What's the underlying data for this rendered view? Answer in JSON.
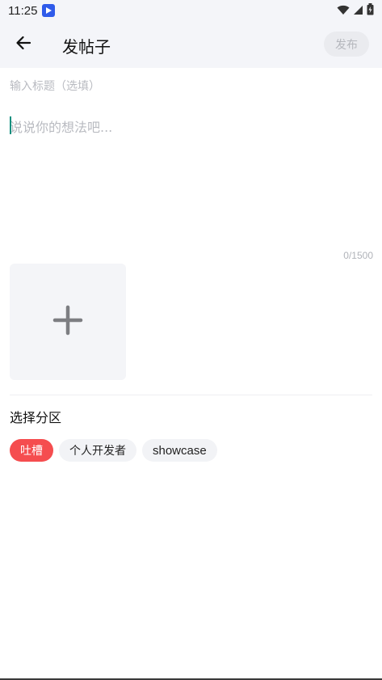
{
  "status_bar": {
    "time": "11:25",
    "app_icon": "play-app-icon",
    "icons": [
      "wifi-icon",
      "signal-icon",
      "battery-icon"
    ]
  },
  "app_bar": {
    "back_icon": "arrow-left-icon",
    "title": "发帖子",
    "publish_label": "发布"
  },
  "editor": {
    "title_placeholder": "输入标题（选填）",
    "title_value": "",
    "content_placeholder": "说说你的想法吧...",
    "content_value": "",
    "counter": "0/1500",
    "add_image_icon": "plus-icon"
  },
  "section": {
    "label": "选择分区",
    "chips": [
      {
        "label": "吐槽",
        "selected": true
      },
      {
        "label": "个人开发者",
        "selected": false
      },
      {
        "label": "showcase",
        "selected": false
      }
    ]
  },
  "colors": {
    "accent": "#f54d4f",
    "caret": "#0a8f7e",
    "header_bg": "#f4f5f9"
  }
}
